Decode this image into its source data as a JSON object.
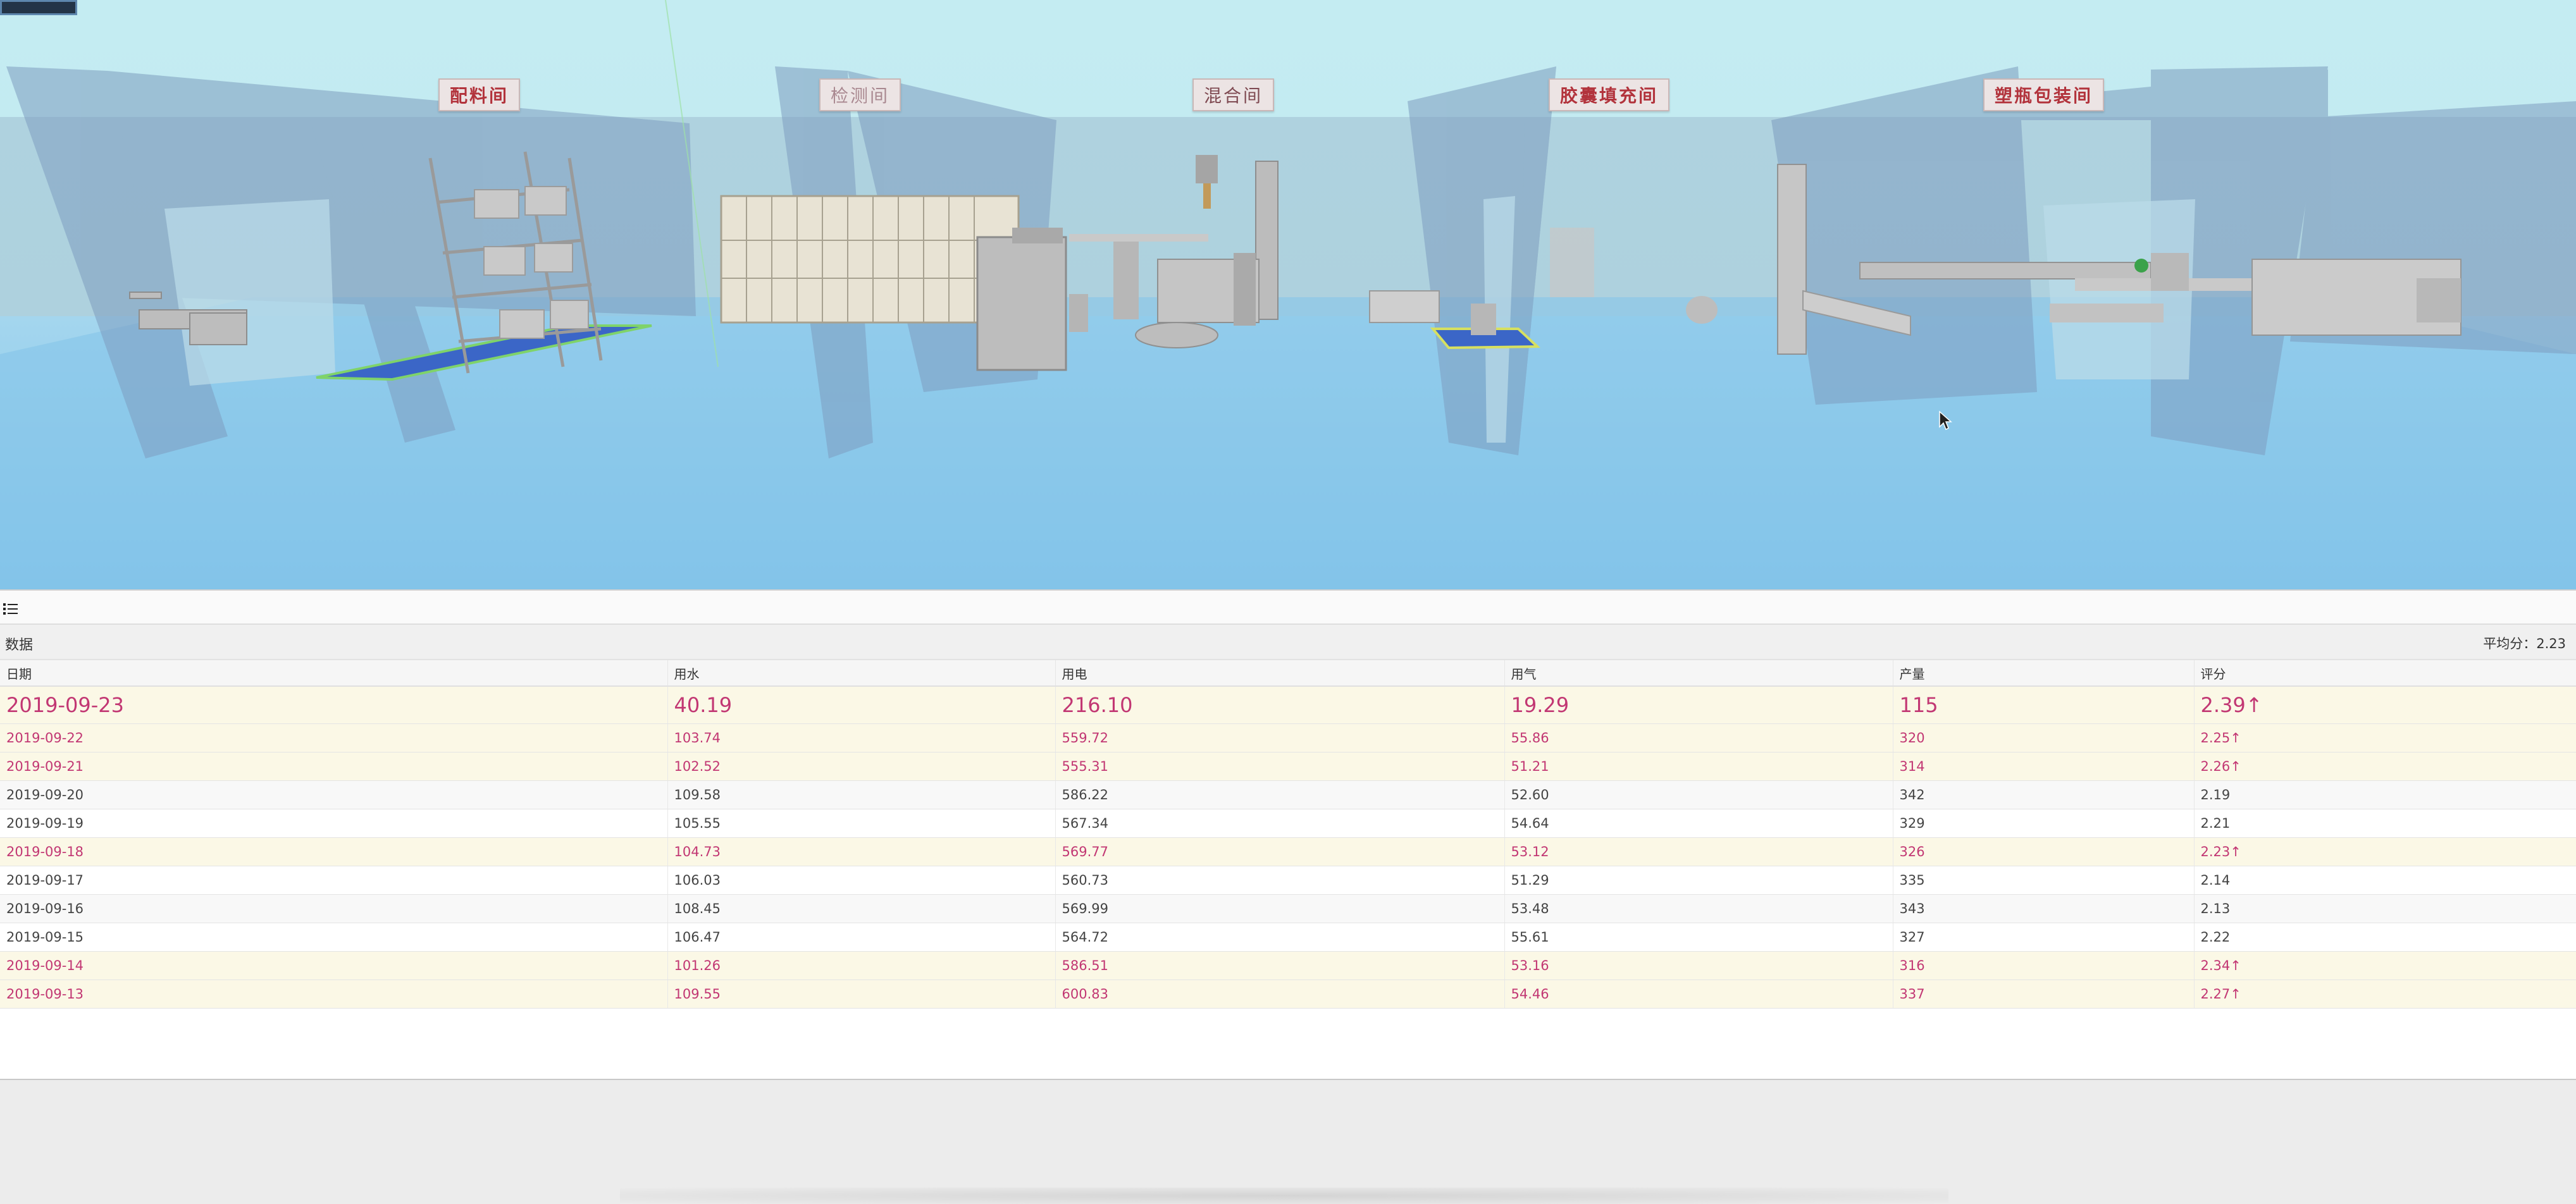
{
  "scene": {
    "rooms": [
      {
        "label": "配料间"
      },
      {
        "label": "检测间"
      },
      {
        "label": "混合间"
      },
      {
        "label": "胶囊填充间"
      },
      {
        "label": "塑瓶包装间"
      }
    ],
    "colors": {
      "sky": "#c4ebf1",
      "floor": "#86c7ea",
      "walls": "#8da8c4",
      "label_text": "#b2333c"
    }
  },
  "panel": {
    "title": "数据",
    "average_label": "平均分：2.23",
    "columns": [
      "日期",
      "用水",
      "用电",
      "用气",
      "产量",
      "评分"
    ],
    "rows": [
      {
        "date": "2019-09-23",
        "water": "40.19",
        "power": "216.10",
        "gas": "19.29",
        "output": "115",
        "score": "2.39↑",
        "highlight": true
      },
      {
        "date": "2019-09-22",
        "water": "103.74",
        "power": "559.72",
        "gas": "55.86",
        "output": "320",
        "score": "2.25↑",
        "highlight": true
      },
      {
        "date": "2019-09-21",
        "water": "102.52",
        "power": "555.31",
        "gas": "51.21",
        "output": "314",
        "score": "2.26↑",
        "highlight": true
      },
      {
        "date": "2019-09-20",
        "water": "109.58",
        "power": "586.22",
        "gas": "52.60",
        "output": "342",
        "score": "2.19",
        "highlight": false
      },
      {
        "date": "2019-09-19",
        "water": "105.55",
        "power": "567.34",
        "gas": "54.64",
        "output": "329",
        "score": "2.21",
        "highlight": false
      },
      {
        "date": "2019-09-18",
        "water": "104.73",
        "power": "569.77",
        "gas": "53.12",
        "output": "326",
        "score": "2.23↑",
        "highlight": true
      },
      {
        "date": "2019-09-17",
        "water": "106.03",
        "power": "560.73",
        "gas": "51.29",
        "output": "335",
        "score": "2.14",
        "highlight": false
      },
      {
        "date": "2019-09-16",
        "water": "108.45",
        "power": "569.99",
        "gas": "53.48",
        "output": "343",
        "score": "2.13",
        "highlight": false
      },
      {
        "date": "2019-09-15",
        "water": "106.47",
        "power": "564.72",
        "gas": "55.61",
        "output": "327",
        "score": "2.22",
        "highlight": false
      },
      {
        "date": "2019-09-14",
        "water": "101.26",
        "power": "586.51",
        "gas": "53.16",
        "output": "316",
        "score": "2.34↑",
        "highlight": true
      },
      {
        "date": "2019-09-13",
        "water": "109.55",
        "power": "600.83",
        "gas": "54.46",
        "output": "337",
        "score": "2.27↑",
        "highlight": true
      }
    ],
    "colors": {
      "highlight_text": "#c23773",
      "highlight_bg": "#fbf8e6"
    }
  }
}
